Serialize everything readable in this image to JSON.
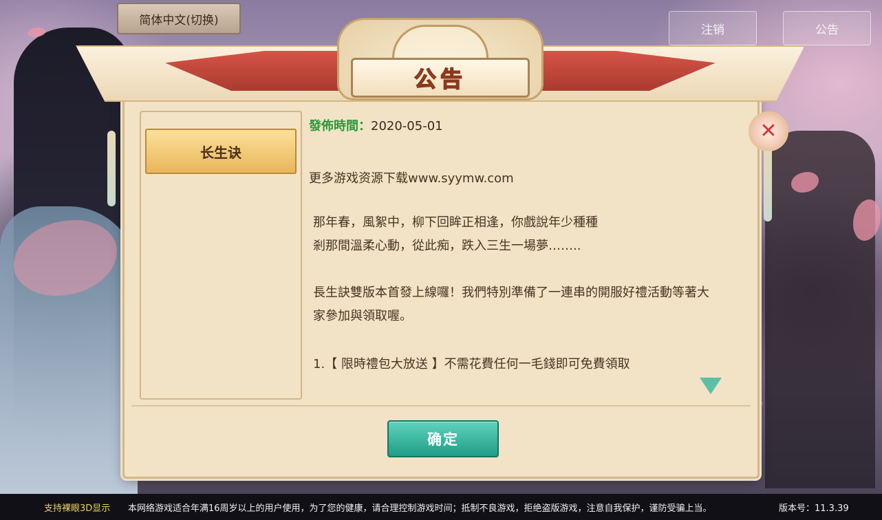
{
  "top_bar": {
    "language_button": "简体中文(切换)",
    "logout_button": "注销",
    "announcement_button": "公告"
  },
  "dialog": {
    "title": "公告",
    "tabs": [
      "长生诀"
    ],
    "publish_label": "發佈時間：",
    "publish_date": "2020-05-01",
    "paragraphs": [
      "更多游戏资源下载www.syymw.com",
      "那年春，風絮中，柳下回眸正相逢，你戲說年少種種",
      "剎那間溫柔心動，從此痴，跌入三生一場夢……..",
      "長生訣雙版本首發上線囉！我們特別準備了一連串的開服好禮活動等著大",
      "家參加與領取喔。",
      "1.【 限時禮包大放送 】不需花費任何一毛錢即可免費領取"
    ],
    "confirm_button": "确定",
    "close_icon": "close-icon",
    "scroll_indicator": "down-arrow-icon"
  },
  "footer": {
    "left": "支持裸眼3D显示",
    "notice": "本网络游戏适合年满16周岁以上的用户使用，为了您的健康，请合理控制游戏时间；抵制不良游戏，拒绝盗版游戏，注意自我保护，谨防受骗上当。",
    "version": "版本号：11.3.39"
  },
  "colors": {
    "publish_label": "#2a9a3a",
    "confirm_button": "#1f9d86",
    "footer_bg": "#111016",
    "tab_active": "#e9b65a"
  }
}
